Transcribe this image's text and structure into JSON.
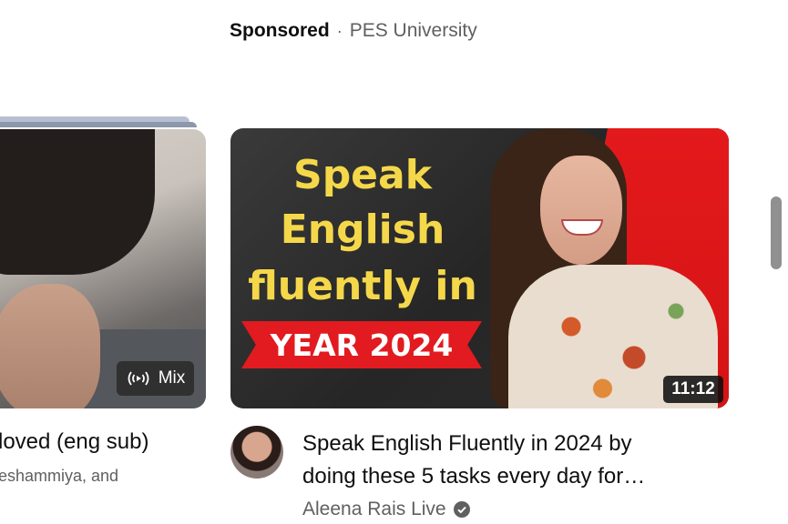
{
  "top_fragment": "’",
  "ad": {
    "label": "Sponsored",
    "separator": "·",
    "advertiser": "PES University"
  },
  "left_card": {
    "badge_label": "Mix",
    "badge_icon": "mix-radio-icon",
    "title": "loved (eng sub)",
    "meta": "eshammiya, and"
  },
  "video": {
    "thumbnail_text": {
      "line1": "Speak",
      "line2": "English",
      "line3": "fluently in",
      "banner": "YEAR 2024"
    },
    "duration": "11:12",
    "title_line1": "Speak English Fluently in 2024 by",
    "title_line2": "doing these 5 tasks every day for…",
    "channel": "Aleena Rais Live",
    "verified_icon": "verified-check-icon"
  },
  "colors": {
    "thumb_yellow": "#f5d84a",
    "thumb_red": "#e11b1f",
    "secondary_text": "#606060"
  }
}
